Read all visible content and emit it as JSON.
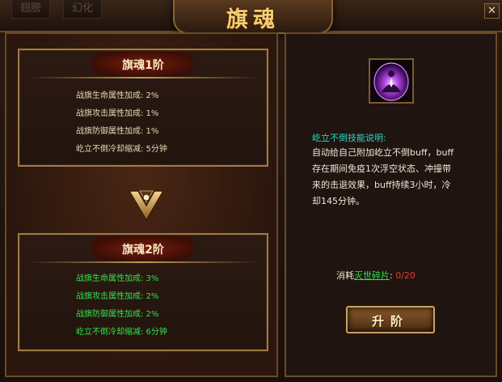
{
  "window": {
    "title": "旗魂",
    "close_glyph": "✕",
    "background_tabs": [
      "翅膀",
      "幻化"
    ]
  },
  "stage1": {
    "title": "旗魂1阶",
    "attributes": [
      "战旗生命属性加成: 2%",
      "战旗攻击属性加成: 1%",
      "战旗防御属性加成: 1%",
      "屹立不倒冷却缩减: 5分钟"
    ]
  },
  "stage2": {
    "title": "旗魂2阶",
    "attributes": [
      "战旗生命属性加成: 3%",
      "战旗攻击属性加成: 2%",
      "战旗防御属性加成: 2%",
      "屹立不倒冷却缩减: 6分钟"
    ]
  },
  "skill": {
    "icon": "purple-shield-aura-icon",
    "title": "屹立不倒技能说明:",
    "description_lines": [
      "自动给自己附加屹立不倒buff，buff",
      "存在期间免疫1次浮空状态、冲撞带",
      "来的击退效果，buff持续3小时，冷",
      "却145分钟。"
    ]
  },
  "cost": {
    "label": "消耗",
    "material": "灭世碎片",
    "separator": ": ",
    "count": "0/20"
  },
  "upgrade_button": {
    "label": "升阶"
  },
  "colors": {
    "gold": "#f3cf72",
    "green": "#2fe54b",
    "cyan": "#26d7c1",
    "red": "#e63b2c"
  }
}
